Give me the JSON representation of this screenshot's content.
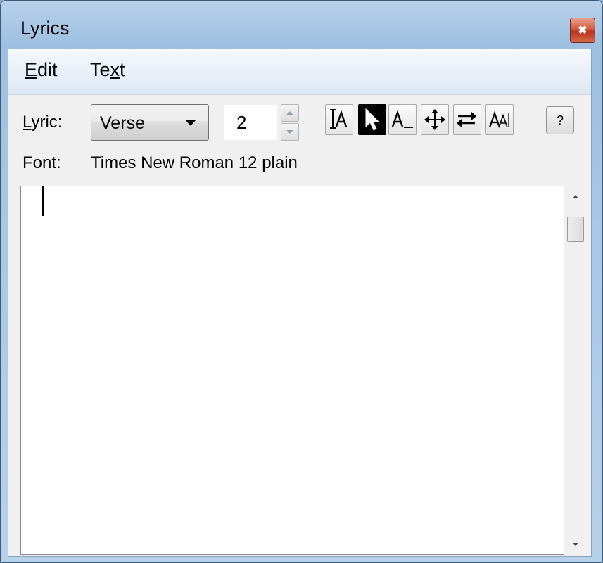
{
  "window": {
    "title": "Lyrics",
    "close_glyph": "✖"
  },
  "menu": {
    "edit_prefix": "E",
    "edit_rest": "dit",
    "text_pre": "Te",
    "text_ul": "x",
    "text_post": "t"
  },
  "toolbar": {
    "lyric_label_ul": "L",
    "lyric_label_rest": "yric:",
    "lyric_type": "Verse",
    "verse_number": "2",
    "tools": [
      "text-insert-icon",
      "pointer-icon",
      "underscore-text-icon",
      "move-icon",
      "swap-arrows-icon",
      "font-size-icon"
    ],
    "selected_tool": "pointer-icon",
    "help_label": "?"
  },
  "font": {
    "label": "Font:",
    "value": "Times New Roman  12 plain"
  },
  "editor": {
    "content": ""
  },
  "colors": {
    "selected_tool_bg": "#000000",
    "title_close": "#c8452d",
    "frame": "#a9c7e6"
  }
}
